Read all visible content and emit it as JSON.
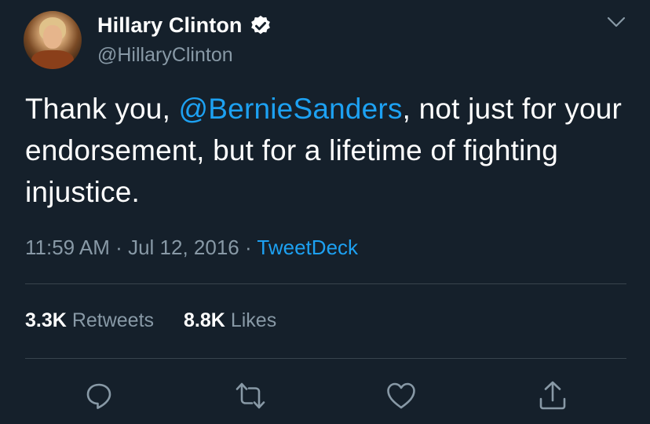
{
  "author": {
    "display_name": "Hillary Clinton",
    "handle": "@HillaryClinton",
    "verified": true
  },
  "tweet": {
    "text_before": "Thank you, ",
    "mention": "@BernieSanders",
    "text_after": ", not just for your endorsement, but for a lifetime of fighting injustice."
  },
  "meta": {
    "time": "11:59 AM",
    "separator": "·",
    "date": "Jul 12, 2016",
    "source": "TweetDeck"
  },
  "stats": {
    "retweets_count": "3.3K",
    "retweets_label": "Retweets",
    "likes_count": "8.8K",
    "likes_label": "Likes"
  },
  "colors": {
    "background": "#15202b",
    "accent": "#1da1f2",
    "secondary_text": "#8899a6",
    "divider": "#38444d"
  },
  "icons": [
    "verified-badge-icon",
    "chevron-down-icon",
    "reply-icon",
    "retweet-icon",
    "like-icon",
    "share-icon"
  ]
}
